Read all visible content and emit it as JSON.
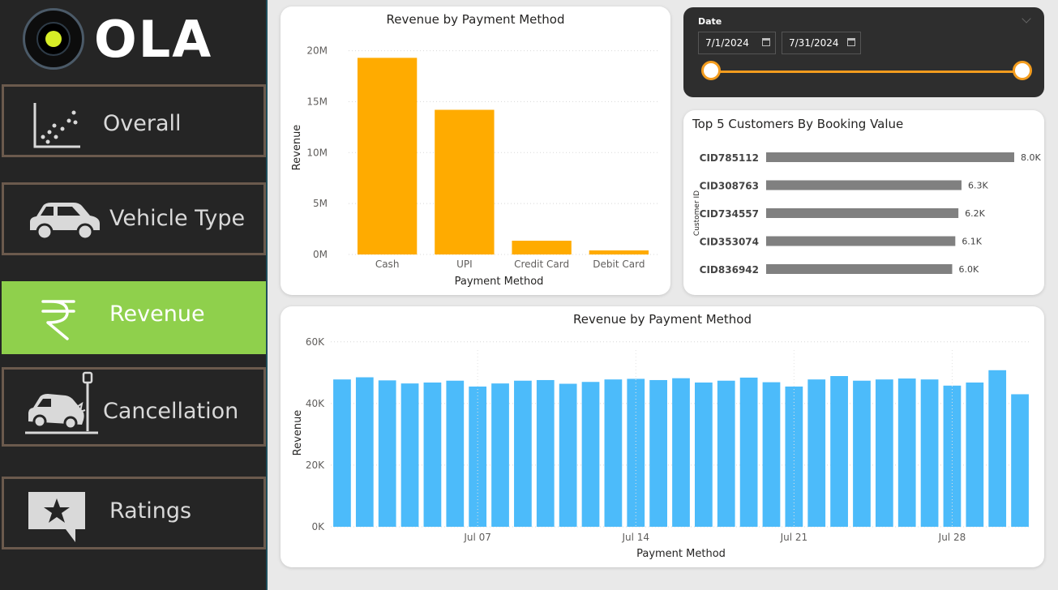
{
  "brand": {
    "name": "OLA",
    "accent": "#d8ee27"
  },
  "nav": {
    "items": [
      {
        "label": "Overall",
        "icon": "scatter-chart-icon"
      },
      {
        "label": "Vehicle Type",
        "icon": "car-icon"
      },
      {
        "label": "Revenue",
        "icon": "rupee-icon",
        "active": true
      },
      {
        "label": "Cancellation",
        "icon": "car-crash-icon"
      },
      {
        "label": "Ratings",
        "icon": "star-message-icon"
      }
    ],
    "active_color": "#8fd04c"
  },
  "date_slicer": {
    "title": "Date",
    "start": "7/1/2024",
    "end": "7/31/2024",
    "range_fraction": [
      0,
      1
    ],
    "accent": "#f39c1e"
  },
  "chart_data": [
    {
      "id": "payment",
      "type": "bar",
      "title": "Revenue by Payment Method",
      "xlabel": "Payment Method",
      "ylabel": "Revenue",
      "categories": [
        "Cash",
        "UPI",
        "Credit Card",
        "Debit Card"
      ],
      "values": [
        19300000,
        14200000,
        1350000,
        400000
      ],
      "yticks": [
        0,
        5000000,
        10000000,
        15000000,
        20000000
      ],
      "ytick_labels": [
        "0M",
        "5M",
        "10M",
        "15M",
        "20M"
      ],
      "ylim": [
        0,
        21000000
      ],
      "grid": true,
      "color": "#ffab00"
    },
    {
      "id": "customers",
      "type": "bar",
      "orientation": "horizontal",
      "title": "Top 5 Customers By Booking Value",
      "ylabel": "Customer ID",
      "categories": [
        "CID785112",
        "CID308763",
        "CID734557",
        "CID353074",
        "CID836942"
      ],
      "values": [
        8000,
        6300,
        6200,
        6100,
        6000
      ],
      "data_labels": [
        "8.0K",
        "6.3K",
        "6.2K",
        "6.1K",
        "6.0K"
      ],
      "color": "#808080"
    },
    {
      "id": "daily",
      "type": "bar",
      "title": "Revenue by Payment Method",
      "xlabel": "Payment Method",
      "ylabel": "Revenue",
      "x": [
        "2024-07-01",
        "2024-07-02",
        "2024-07-03",
        "2024-07-04",
        "2024-07-05",
        "2024-07-06",
        "2024-07-07",
        "2024-07-08",
        "2024-07-09",
        "2024-07-10",
        "2024-07-11",
        "2024-07-12",
        "2024-07-13",
        "2024-07-14",
        "2024-07-15",
        "2024-07-16",
        "2024-07-17",
        "2024-07-18",
        "2024-07-19",
        "2024-07-20",
        "2024-07-21",
        "2024-07-22",
        "2024-07-23",
        "2024-07-24",
        "2024-07-25",
        "2024-07-26",
        "2024-07-27",
        "2024-07-28",
        "2024-07-29",
        "2024-07-30",
        "2024-07-31"
      ],
      "values": [
        47800,
        48500,
        47500,
        46500,
        46800,
        47400,
        45500,
        46500,
        47400,
        47600,
        46400,
        47000,
        47800,
        48000,
        47600,
        48200,
        46800,
        47400,
        48400,
        46900,
        45500,
        47800,
        48900,
        47400,
        47800,
        48100,
        47800,
        45800,
        46800,
        50800,
        43000
      ],
      "xtick_labels": [
        {
          "date": "2024-07-07",
          "label": "Jul 07"
        },
        {
          "date": "2024-07-14",
          "label": "Jul 14"
        },
        {
          "date": "2024-07-21",
          "label": "Jul 21"
        },
        {
          "date": "2024-07-28",
          "label": "Jul 28"
        }
      ],
      "yticks": [
        0,
        20000,
        40000,
        60000
      ],
      "ytick_labels": [
        "0K",
        "20K",
        "40K",
        "60K"
      ],
      "ylim": [
        0,
        61000
      ],
      "grid": true,
      "color": "#4cbbfa"
    }
  ]
}
